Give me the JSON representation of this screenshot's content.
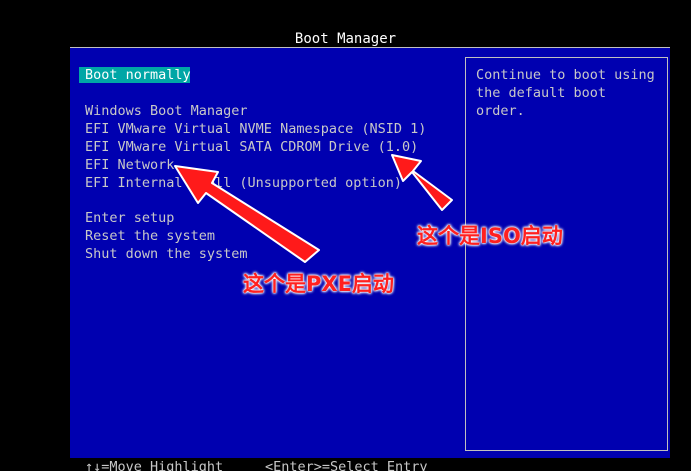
{
  "window": {
    "title": "Boot Manager"
  },
  "menu": {
    "selected": "Boot normally",
    "boot_options": [
      "Windows Boot Manager",
      "EFI VMware Virtual NVME Namespace (NSID 1)",
      "EFI VMware Virtual SATA CDROM Drive (1.0)",
      "EFI Network",
      "EFI Internal Shell (Unsupported option)"
    ],
    "system_options": [
      "Enter setup",
      "Reset the system",
      "Shut down the system"
    ]
  },
  "help": {
    "text": "Continue to boot using the default boot order."
  },
  "footer": {
    "move_hint": "↑↓=Move Highlight",
    "select_hint": "<Enter>=Select Entry"
  },
  "annotations": {
    "iso_label": "这个是ISO启动",
    "pxe_label": "这个是PXE启动",
    "color": "#ff2020"
  },
  "colors": {
    "background": "#0000b0",
    "highlight": "#00a6a6",
    "text": "#c8c8c8"
  }
}
